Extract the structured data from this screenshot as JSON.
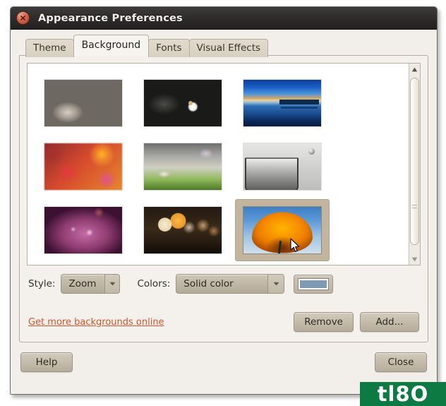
{
  "window": {
    "title": "Appearance Preferences",
    "close_icon": "close-icon"
  },
  "tabs": [
    {
      "label": "Theme",
      "active": false
    },
    {
      "label": "Background",
      "active": true
    },
    {
      "label": "Fonts",
      "active": false
    },
    {
      "label": "Visual Effects",
      "active": false
    }
  ],
  "wallpapers": [
    {
      "name": "stones",
      "selected": false
    },
    {
      "name": "white-flower-black",
      "selected": false
    },
    {
      "name": "pier-sunset-blue",
      "selected": false
    },
    {
      "name": "red-orange-blur",
      "selected": false
    },
    {
      "name": "misty-green-grass",
      "selected": false
    },
    {
      "name": "glass-water-bw",
      "selected": false
    },
    {
      "name": "purple-glow",
      "selected": false
    },
    {
      "name": "bokeh-lights",
      "selected": false
    },
    {
      "name": "orange-poppy-sky",
      "selected": true
    }
  ],
  "options": {
    "style_label": "Style:",
    "style_value": "Zoom",
    "colors_label": "Colors:",
    "colors_value": "Solid color",
    "color_swatch_hex": "#7e9ab5",
    "dropdown_icon": "chevron-down-icon"
  },
  "links": {
    "get_more": "Get more backgrounds online"
  },
  "buttons": {
    "remove": "Remove",
    "add": "Add...",
    "help": "Help",
    "close": "Close"
  },
  "scrollbar": {
    "up_icon": "triangle-up-icon",
    "down_icon": "triangle-down-icon"
  },
  "watermark": {
    "text": "tl8O"
  }
}
